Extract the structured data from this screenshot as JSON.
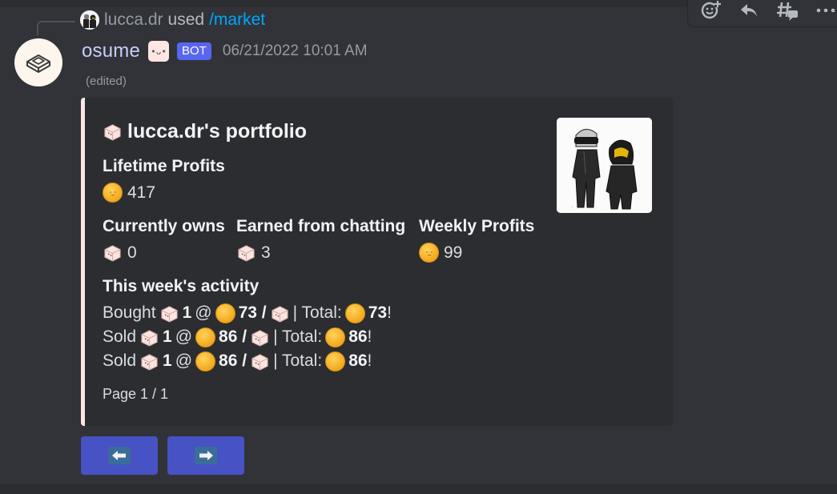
{
  "reply": {
    "user": "lucca.dr",
    "used": "used",
    "command": "/market"
  },
  "message": {
    "username": "osume",
    "bot_tag": "BOT",
    "timestamp": "06/21/2022 10:01 AM",
    "edited": "(edited)"
  },
  "embed": {
    "accent_color": "#fde6e3",
    "title": "lucca.dr's portfolio",
    "title_icon": "keycap-emoji",
    "fields": {
      "lifetime_profits": {
        "name": "Lifetime Profits",
        "value": "417",
        "icon": "coin-emoji"
      },
      "currently_owns": {
        "name": "Currently owns",
        "value": "0",
        "icon": "keycap-emoji"
      },
      "earned_from_chatting": {
        "name": "Earned from chatting",
        "value": "3",
        "icon": "keycap-emoji"
      },
      "weekly_profits": {
        "name": "Weekly Profits",
        "value": "99",
        "icon": "coin-emoji"
      }
    },
    "activity_heading": "This week's activity",
    "activity": [
      {
        "action": "Bought",
        "qty": "1",
        "at": "@",
        "price": "73 /",
        "total_label": "| Total:",
        "total": "73",
        "end": "!"
      },
      {
        "action": "Sold",
        "qty": "1",
        "at": "@",
        "price": "86 /",
        "total_label": "| Total:",
        "total": "86",
        "end": "!"
      },
      {
        "action": "Sold",
        "qty": "1",
        "at": "@",
        "price": "86 /",
        "total_label": "| Total:",
        "total": "86",
        "end": "!"
      }
    ],
    "footer": "Page 1 / 1"
  },
  "buttons": {
    "prev_icon": "left-arrow-icon",
    "next_icon": "right-arrow-icon"
  },
  "toolbar": [
    "add-reaction-icon",
    "reply-icon",
    "create-thread-icon",
    "more-icon"
  ],
  "colors": {
    "background": "#313338",
    "embed_bg": "#2b2d31",
    "blurple": "#5865f2",
    "button": "#4752c4",
    "link": "#00a8fc"
  }
}
